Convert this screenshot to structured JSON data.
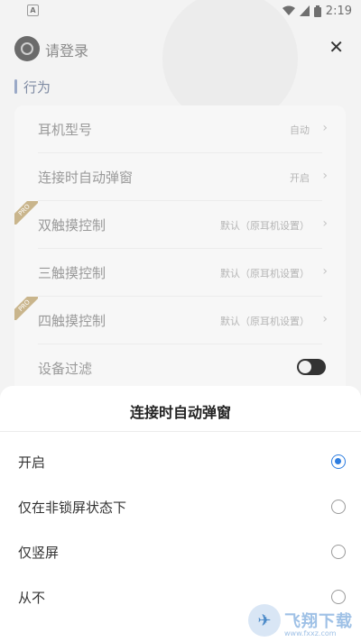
{
  "statusbar": {
    "left_icon": "A",
    "time": "2:19"
  },
  "header": {
    "login_text": "请登录",
    "close_label": "✕"
  },
  "section": {
    "title": "行为"
  },
  "settings": [
    {
      "label": "耳机型号",
      "value": "自动",
      "pro": false,
      "type": "link"
    },
    {
      "label": "连接时自动弹窗",
      "value": "开启",
      "pro": false,
      "type": "link"
    },
    {
      "label": "双触摸控制",
      "value": "默认（原耳机设置）",
      "pro": true,
      "type": "link"
    },
    {
      "label": "三触摸控制",
      "value": "默认（原耳机设置）",
      "pro": false,
      "type": "link"
    },
    {
      "label": "四触摸控制",
      "value": "默认（原耳机设置）",
      "pro": true,
      "type": "link"
    },
    {
      "label": "设备过滤",
      "value": "",
      "pro": false,
      "type": "toggle",
      "toggle_on": false
    }
  ],
  "pro_badge": "PRO",
  "chevron": "›",
  "sheet": {
    "title": "连接时自动弹窗",
    "options": [
      {
        "label": "开启",
        "selected": true
      },
      {
        "label": "仅在非锁屏状态下",
        "selected": false
      },
      {
        "label": "仅竖屏",
        "selected": false
      },
      {
        "label": "从不",
        "selected": false
      }
    ]
  },
  "watermark": {
    "text": "飞翔下载",
    "sub": "www.fxxz.com"
  },
  "colors": {
    "accent": "#2d7de0",
    "section": "#7f8ba3",
    "pro": "#c9b58c"
  }
}
